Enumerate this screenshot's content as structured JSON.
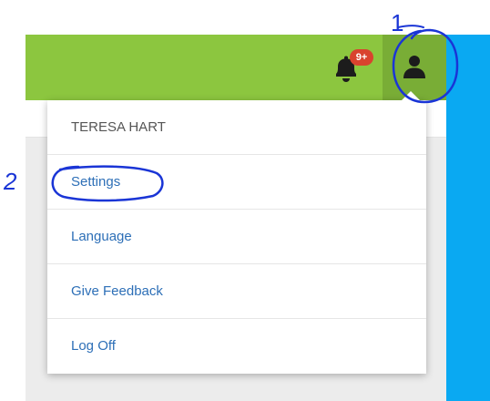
{
  "topbar": {
    "notification_badge": "9+",
    "notification_icon": "bell-icon",
    "user_icon": "user-icon",
    "accent_color": "#8cc63f",
    "user_button_color": "#79ad36",
    "badge_color": "#d9432e"
  },
  "menu": {
    "user_name": "TERESA HART",
    "items": [
      {
        "label": "Settings"
      },
      {
        "label": "Language"
      },
      {
        "label": "Give Feedback"
      },
      {
        "label": "Log Off"
      }
    ],
    "link_color": "#2d6fb7"
  },
  "annotations": {
    "step1": "1",
    "step2": "2",
    "ink_color": "#1a35d6"
  }
}
